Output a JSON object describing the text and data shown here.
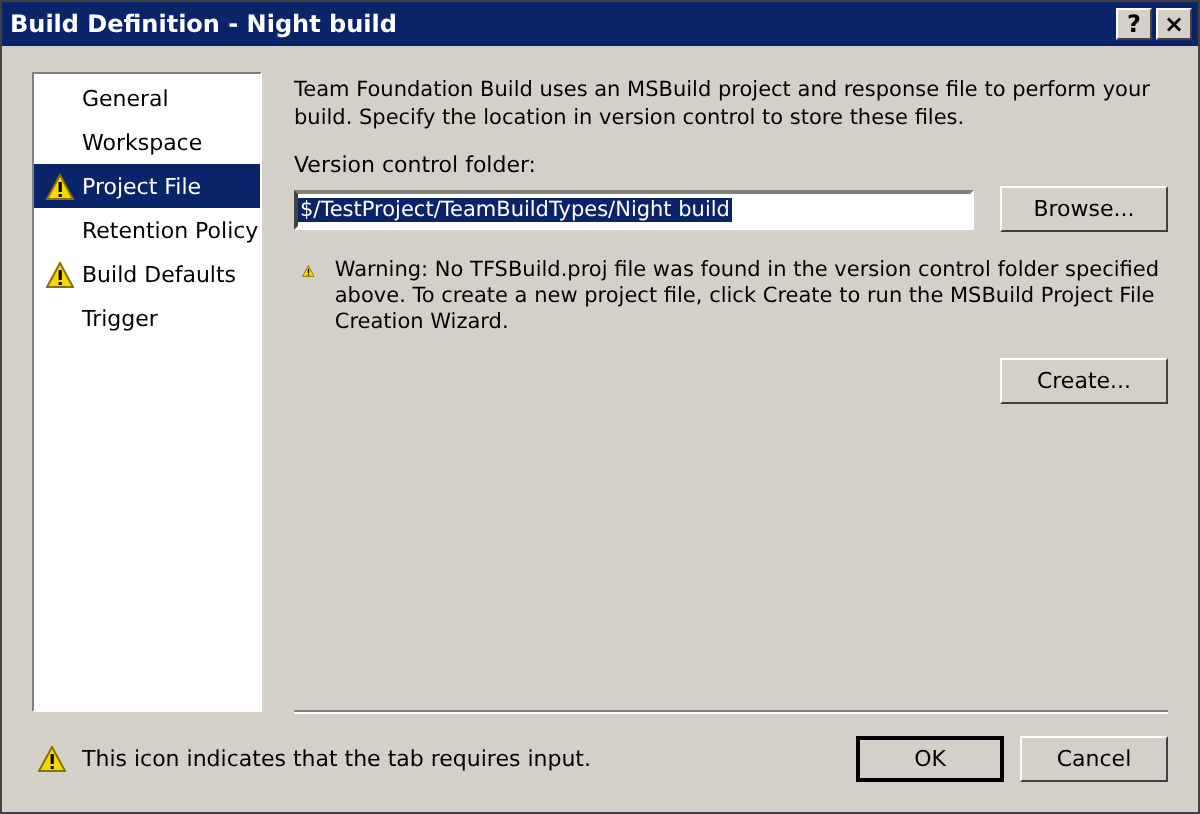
{
  "window": {
    "title": "Build Definition - Night build",
    "help_button": "?",
    "close_button": "×"
  },
  "sidebar": {
    "items": [
      {
        "label": "General",
        "selected": false,
        "warning": false
      },
      {
        "label": "Workspace",
        "selected": false,
        "warning": false
      },
      {
        "label": "Project File",
        "selected": true,
        "warning": true
      },
      {
        "label": "Retention Policy",
        "selected": false,
        "warning": false
      },
      {
        "label": "Build Defaults",
        "selected": false,
        "warning": true
      },
      {
        "label": "Trigger",
        "selected": false,
        "warning": false
      }
    ]
  },
  "description": "Team Foundation Build uses an MSBuild project and response file to perform your build. Specify the location in version control to store these files.",
  "version_folder": {
    "label": "Version control folder:",
    "value": "$/TestProject/TeamBuildTypes/Night build"
  },
  "browse_button": "Browse...",
  "warning": "Warning: No TFSBuild.proj file was found in the version control folder specified above. To create a new project file, click Create to run the MSBuild Project File Creation Wizard.",
  "create_button": "Create...",
  "footer_note": "This icon indicates that the tab requires input.",
  "buttons": [
    "OK",
    "Cancel"
  ]
}
